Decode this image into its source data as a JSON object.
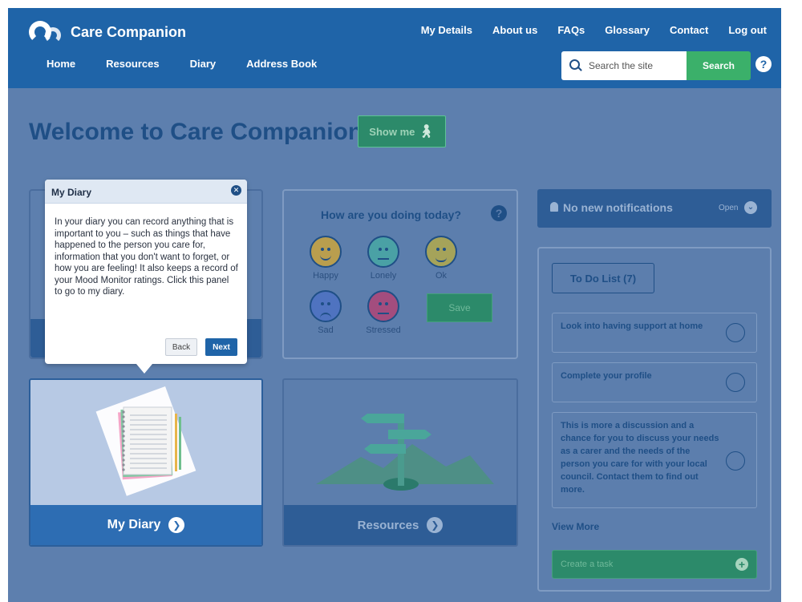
{
  "header": {
    "logo_text": "Care Companion",
    "top_nav": [
      "My Details",
      "About us",
      "FAQs",
      "Glossary",
      "Contact",
      "Log out"
    ],
    "main_nav": [
      "Home",
      "Resources",
      "Diary",
      "Address Book"
    ],
    "search_placeholder": "Search the site",
    "search_button": "Search",
    "help_icon": "?"
  },
  "welcome": {
    "title": "Welcome to Care Companion",
    "show_me": "Show me",
    "show_me_icon": "walking-person-icon"
  },
  "tooltip": {
    "title": "My Diary",
    "body": "In your diary you can record anything that is important to you – such as things that have happened to the person you care for, information that you don't want to forget, or how you are feeling! It also keeps a record of your Mood Monitor ratings. Click this panel to go to my diary.",
    "back": "Back",
    "next": "Next"
  },
  "mood": {
    "title": "How are you doing today?",
    "help": "?",
    "faces": [
      {
        "label": "Happy",
        "color": "#b99e4e"
      },
      {
        "label": "Lonely",
        "color": "#4aa1a5"
      },
      {
        "label": "Ok",
        "color": "#a5a35a"
      },
      {
        "label": "Sad",
        "color": "#4f73c0"
      },
      {
        "label": "Stressed",
        "color": "#a34d7e"
      }
    ],
    "save": "Save"
  },
  "notifications": {
    "text": "No new notifications",
    "open": "Open"
  },
  "todo": {
    "title": "To Do List (7)",
    "tasks": [
      "Look into having support at home",
      "Complete your profile",
      "This is more a discussion and a chance for you to discuss your needs as a carer and the needs of the person you care for with your local council. Contact them to find out more."
    ],
    "view_more": "View More",
    "create_task": "Create a task"
  },
  "cards": {
    "diary": "My Diary",
    "resources": "Resources"
  },
  "colors": {
    "header_blue": "#1f64a8",
    "overlay": "#5d7fae",
    "accent_green": "#3bb06a"
  }
}
